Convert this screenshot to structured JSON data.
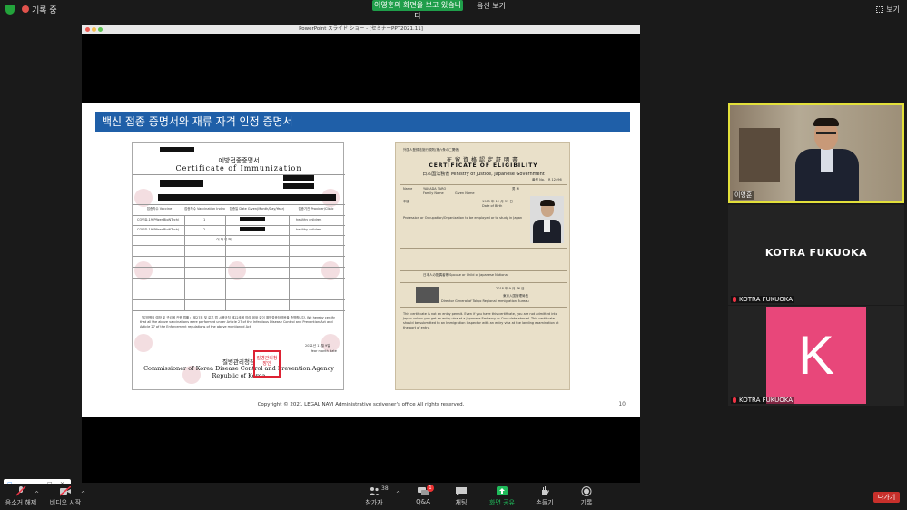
{
  "topbar": {
    "recording_label": "기록 중",
    "viewing_banner": "이영훈의 화면을 보고 있습니다",
    "options_label": "옵션 보기",
    "view_label": "보기"
  },
  "share_window": {
    "title": "PowerPoint スライド ショー - [セミナーPPT2021.11]",
    "slide": {
      "title": "백신 접종 증명서와 재류 자격 인정 증명서",
      "footer": "Copyright © 2021 LEGAL NAVI Administrative scrivener's office All rights reserved.",
      "page_number": "10",
      "vaccine_cert": {
        "title_kr": "예방접종증명서",
        "title_en": "Certificate of Immunization",
        "col_headers": [
          "접종차수 Vaccine",
          "접종차수 Vaccination Index",
          "접종일 Date Given(Month/Day/Year)",
          "접종기관 Provider/Clinic"
        ],
        "rows": [
          [
            "COVID-19(Pfizer-BioNTech)",
            "1",
            "",
            "healthy children"
          ],
          [
            "COVID-19(Pfizer-BioNTech)",
            "2",
            "",
            "healthy children"
          ]
        ],
        "below_text": "- 이 하 여 백 -",
        "body_text": "「감염병의 예방 및 관리에 관한 법률」 제27조 및 같은 법 시행규칙 제22조에 따라 위와 같이 예방접종하였음을 증명합니다. We hereby certify that all the above vaccinations were performed under Article 27 of the Infectious Disease Control and Prevention Act and Article 27 of the Enforcement regulations of the above mentioned Act.",
        "date_text": "2021년 11월 9일",
        "date_en": "Year month date",
        "agency_kr": "질병관리청장",
        "agency_en_line1": "Commissioner of Korea Disease Control and Prevention Agency",
        "agency_en_line2": "Republic of Korea",
        "seal_text": "질병관리청장인"
      },
      "coe": {
        "header_small": "外国人登録法施行規則(第六条の二関係)",
        "title_jp": "在留資格認定証明書",
        "title_en": "CERTIFICATE OF ELIGIBILITY",
        "issuer": "日本国法務省 Ministry of Justice, Japanese Government",
        "number_label": "番号 No.",
        "number_value": "R 12496",
        "name_label": "Name",
        "family_name_label": "Family Name",
        "given_name_label": "Given Name",
        "family_name_value": "YAMADA TARO",
        "sex": "男 M",
        "dob_label": "Date of Birth",
        "dob_value": "1985 年 12 月 31 日",
        "nationality": "中國",
        "activity_label": "Profession or Occupation/Organization to be employed or to study in Japan",
        "status_label": "日本人の配偶者等 Spouse or Child of Japanese National",
        "issue_date": "2018 年 9 月 16 日",
        "director": "Director General of Tokyo Regional Immigration Bureau",
        "bureau": "東京入国管理局長",
        "notes": "This certificate is not an entry permit. Even if you have this certificate, you are not admitted into Japan unless you get an entry visa at a Japanese Embassy or Consulate abroad. This certificate should be submitted to an Immigration Inspector with an entry visa at the landing examination at the port of entry."
      }
    }
  },
  "participants": [
    {
      "name": "이영훈",
      "type": "video"
    },
    {
      "name": "KOTRA FUKUOKA",
      "display": "KOTRA FUKUOKA",
      "type": "name-only",
      "muted": true
    },
    {
      "name": "KOTRA FUKUOKA",
      "initial": "K",
      "type": "avatar",
      "muted": true,
      "color": "#e8477a"
    }
  ],
  "toolbar": {
    "mute_label": "음소거 해제",
    "video_label": "비디오 시작",
    "participants_label": "참가자",
    "participants_count": "38",
    "qa_label": "Q&A",
    "qa_badge": "1",
    "chat_label": "채팅",
    "share_label": "화면 공유",
    "raise_hand_label": "손들기",
    "record_label": "기록",
    "leave_label": "나가기"
  },
  "colors": {
    "share_banner": "#1f9e4a",
    "slide_title_bar": "#1f5fa8",
    "active_speaker_border": "#e3e03a",
    "leave_button": "#c8302b",
    "avatar_bg": "#e8477a"
  }
}
